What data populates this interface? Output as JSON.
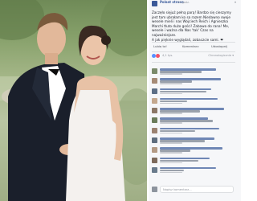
{
  "post": {
    "page_name": "Polsat strona",
    "timestamp": "11 godz.",
    "menu": "▾",
    "caption": [
      "Zaczęło sięjuż pełną parą! Bardzo się cieszymy",
      "jest tam ubrałam ko sa razem Niedawno swoje",
      "wesele mieli i nas Wojciech Reich i Agnieszka",
      "Marchi tłuto dużo gości! Zabawa do rana! Me,",
      "wesele i ważna dla Nas 'tak' Czas na najważniejsze.",
      "A jak pięknie wyglądali, zobaczcie sami. ❤"
    ],
    "actions": {
      "like": "Lubię to!",
      "comment": "Komentarz",
      "share": "Udostępnij"
    },
    "reactions": {
      "count": "4,1 tys.",
      "sort": "Chronologicznie ▾"
    },
    "comment_box_placeholder": "Napisz komentarz..."
  },
  "colors": {
    "facebook_blue": "#3b5998",
    "like_blue": "#5890ff",
    "love_red": "#f25268",
    "text_dark": "#1d2129",
    "link": "#365899"
  }
}
